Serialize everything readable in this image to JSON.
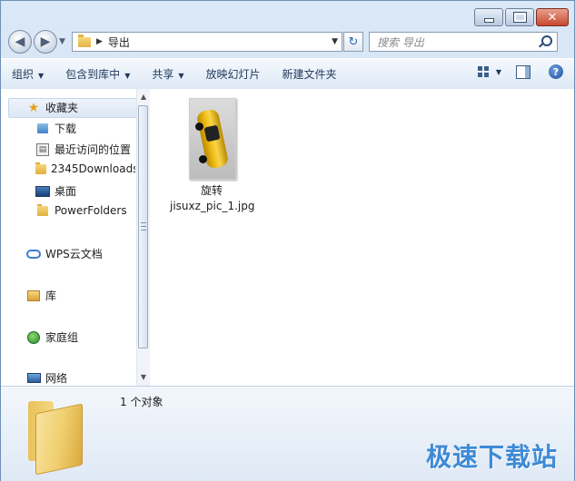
{
  "address": {
    "folder_name": "导出"
  },
  "search": {
    "placeholder": "搜索 导出"
  },
  "toolbar": {
    "organize": "组织",
    "include_in_library": "包含到库中",
    "share": "共享",
    "slideshow": "放映幻灯片",
    "new_folder": "新建文件夹"
  },
  "nav": {
    "favorites": "收藏夹",
    "downloads": "下载",
    "recent": "最近访问的位置",
    "folder_2345": "2345Downloads",
    "desktop": "桌面",
    "powerfolders": "PowerFolders",
    "wps_cloud": "WPS云文档",
    "libraries": "库",
    "homegroup": "家庭组",
    "network": "网络"
  },
  "files": [
    {
      "name_line1": "旋转",
      "name_line2": "jisuxz_pic_1.jpg"
    }
  ],
  "status": {
    "count": "1 个对象"
  },
  "watermark": "极速下载站",
  "colors": {
    "accent": "#3e8ad6",
    "toolbar_text": "#1e395b"
  }
}
